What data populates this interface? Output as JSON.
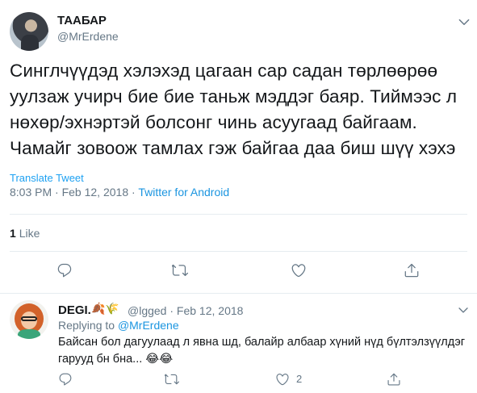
{
  "tweet": {
    "author_name": "ТААБАР",
    "author_handle": "@MrErdene",
    "text": "Синглчүүдэд хэлэхэд цагаан сар садан төрлөөрөө уулзаж учирч бие бие таньж мэддэг баяр. Тиймээс л нөхөр/эхнэртэй болсонг чинь асуугаад байгаам. Чамайг зовоож тамлах гэж байгаа даа биш шүү хэхэ",
    "translate_label": "Translate Tweet",
    "time": "8:03 PM",
    "date": "Feb 12, 2018",
    "separator": " · ",
    "source": "Twitter for Android",
    "likes_count": "1",
    "likes_label": "Like"
  },
  "reply": {
    "author_name": "DEGI.",
    "name_emoji": "🍂🌾",
    "author_handle": "@lgged",
    "separator": " · ",
    "date": "Feb 12, 2018",
    "replying_prefix": "Replying to ",
    "replying_to": "@MrErdene",
    "text": "Байсан бол дагуулаад л явна шд, балайр албаар хүний нүд бүлтэлзүүлдэг гарууд бн бна... 😂😂",
    "like_count": "2"
  },
  "icons": {
    "reply": "reply-icon",
    "retweet": "retweet-icon",
    "like": "heart-icon",
    "share": "share-icon",
    "caret": "chevron-down-icon"
  },
  "colors": {
    "accent": "#1da1f2",
    "link": "#1b95e0",
    "secondary_text": "#657786",
    "divider": "#e6ecf0"
  }
}
